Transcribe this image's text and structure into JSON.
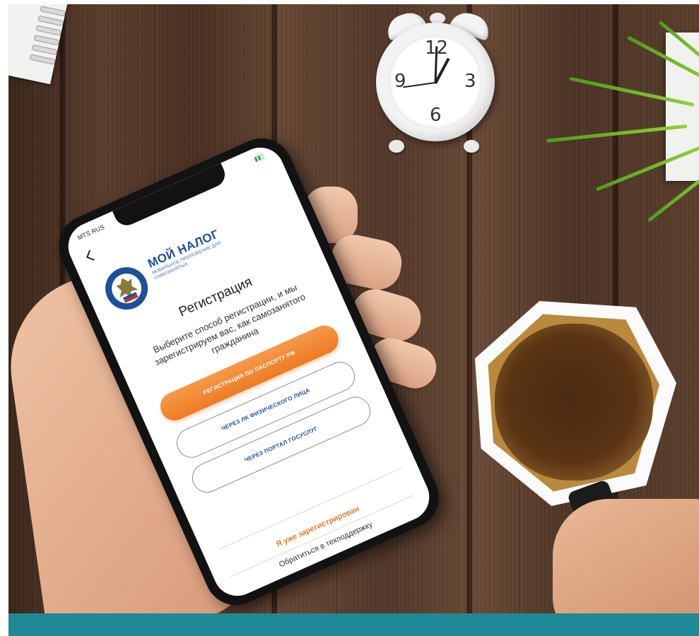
{
  "phone": {
    "status": {
      "carrier": "MTS RUS",
      "battery": "▮▮▯"
    },
    "app": {
      "brand": "МОЙ НАЛОГ",
      "brand_sub": "МОБИЛЬНОЕ ПРИЛОЖЕНИЕ ДЛЯ САМОЗАНЯТЫХ",
      "title": "Регистрация",
      "description": "Выберите способ регистрации, и мы зарегистрируем вас, как самозанятого гражданина",
      "buttons": {
        "passport": "РЕГИСТРАЦИЯ ПО ПАСПОРТУ РФ",
        "lk": "ЧЕРЕЗ ЛК ФИЗИЧЕСКОГО ЛИЦА",
        "gosuslugi": "ЧЕРЕЗ ПОРТАЛ ГОСУСЛУГ"
      },
      "links": {
        "registered": "Я уже зарегистрирован",
        "support": "Обратиться в техподдержку"
      }
    }
  },
  "clock": {
    "n12": "12",
    "n3": "3",
    "n6": "6",
    "n9": "9"
  },
  "colors": {
    "brand_blue": "#1d4f9a",
    "accent_orange": "#ee7a22",
    "footer_teal": "#1e8a96"
  }
}
